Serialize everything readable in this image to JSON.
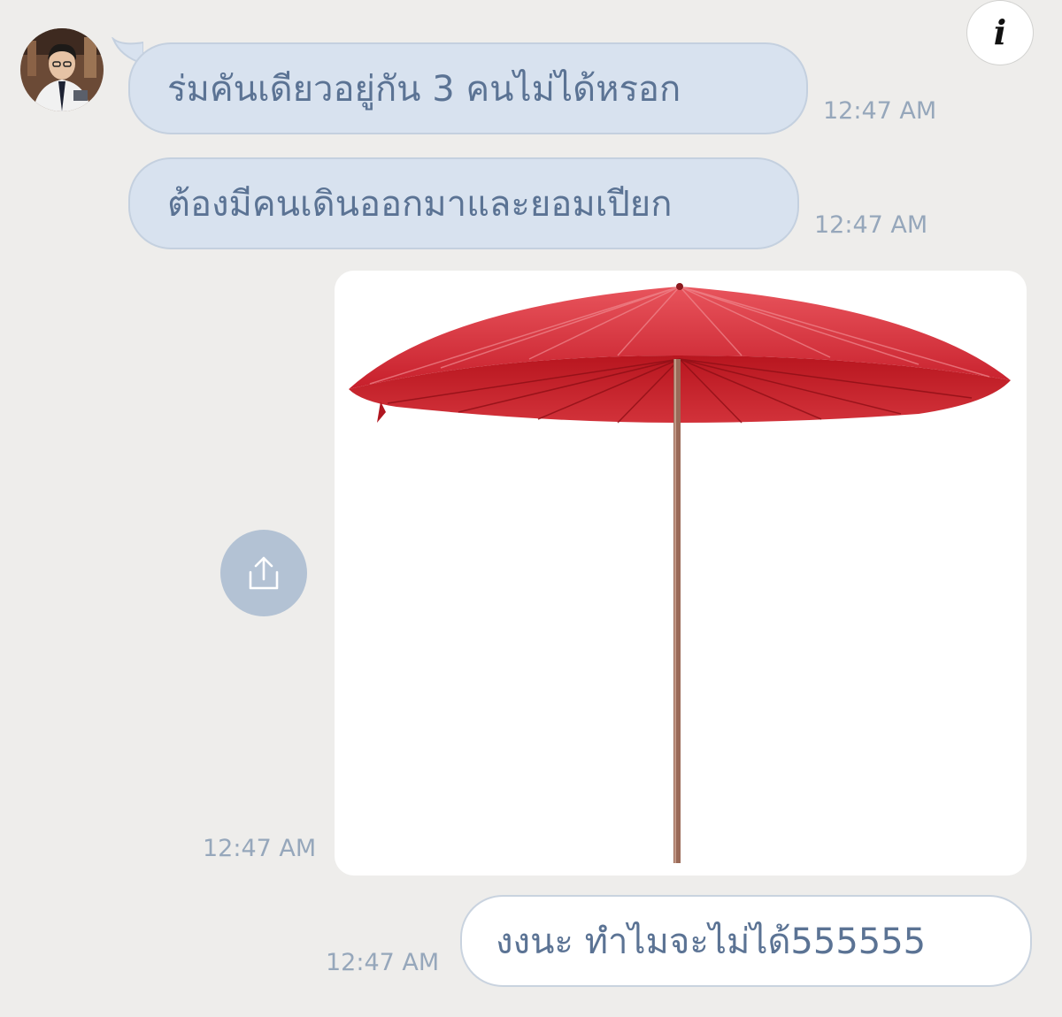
{
  "header": {
    "info_icon": "info-icon",
    "info_label": "i"
  },
  "avatar": {
    "icon": "avatar-icon"
  },
  "messages": [
    {
      "direction": "incoming",
      "text": "ร่มคันเดียวอยู่กัน 3 คนไม่ได้หรอก",
      "time": "12:47 AM"
    },
    {
      "direction": "incoming",
      "text": "ต้องมีคนเดินออกมาและยอมเปียก",
      "time": "12:47 AM"
    },
    {
      "direction": "incoming",
      "type": "image",
      "image_subject": "umbrella",
      "time": "12:47 AM"
    },
    {
      "direction": "outgoing",
      "text": "งงนะ ทำไมจะไม่ได้555555",
      "time": "12:47 AM"
    }
  ],
  "actions": {
    "share_icon": "share-icon"
  },
  "colors": {
    "background": "#eeedeb",
    "incoming_bubble": "#d8e2ef",
    "outgoing_bubble": "#ffffff",
    "text": "#5b7394",
    "timestamp": "#96a7bb",
    "share_button": "#b3c2d4",
    "umbrella_canopy": "#cf2b34"
  }
}
